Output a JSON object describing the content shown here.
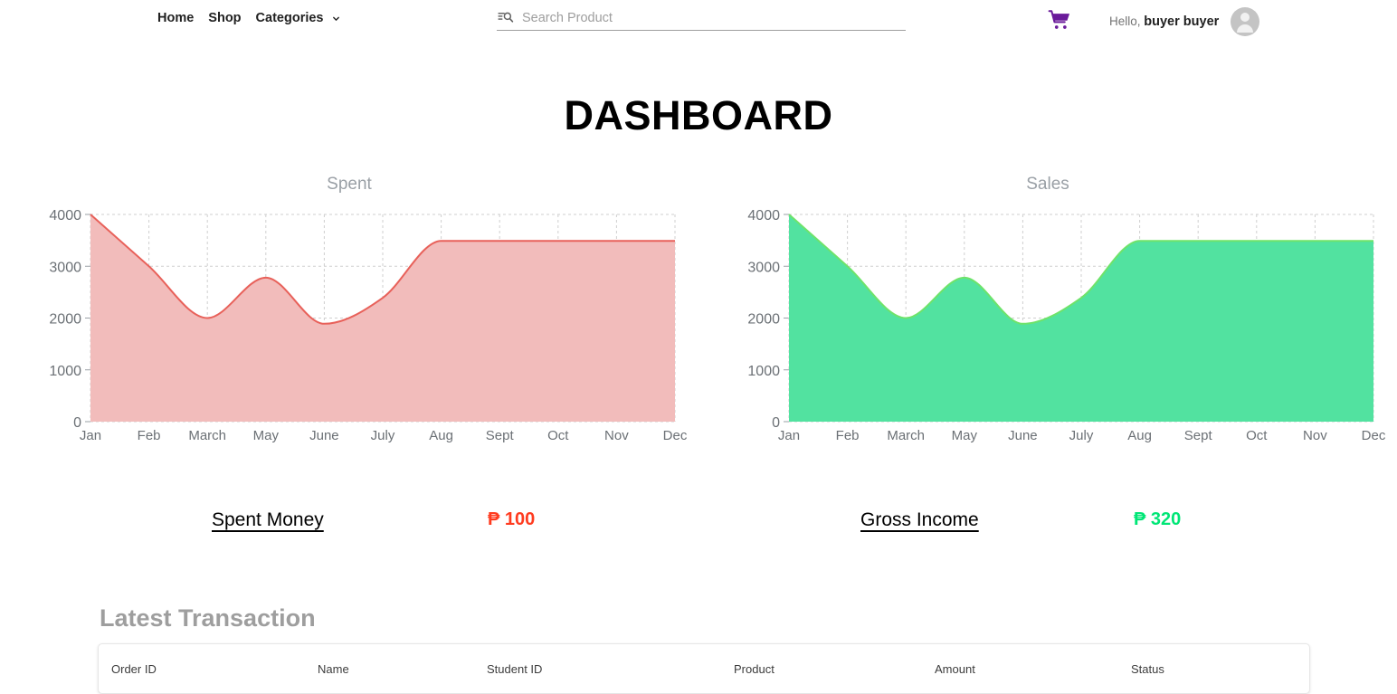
{
  "header": {
    "nav": [
      {
        "label": "Home",
        "name": "nav-home"
      },
      {
        "label": "Shop",
        "name": "nav-shop"
      },
      {
        "label": "Categories",
        "name": "nav-categories"
      }
    ],
    "search": {
      "placeholder": "Search Product",
      "value": "",
      "icon": "manage-search-icon"
    },
    "cart_icon": "shopping-cart-icon",
    "cart_color": "#6a1b9a",
    "greeting_prefix": "Hello,",
    "user_name": "buyer buyer",
    "avatar_icon": "account-circle-icon"
  },
  "page_title": "DASHBOARD",
  "summary": {
    "spent": {
      "label": "Spent Money",
      "value": "₱ 100",
      "color": "#ff3b1f"
    },
    "income": {
      "label": "Gross Income",
      "value": "₱ 320",
      "color": "#00e676"
    }
  },
  "transactions": {
    "heading": "Latest Transaction",
    "columns": [
      "Order ID",
      "Name",
      "Student ID",
      "Product",
      "Amount",
      "Status"
    ],
    "rows": []
  },
  "chart_data": [
    {
      "type": "area",
      "title": "Spent",
      "categories": [
        "Jan",
        "Feb",
        "March",
        "May",
        "June",
        "July",
        "Aug",
        "Sept",
        "Oct",
        "Nov",
        "Dec"
      ],
      "values": [
        4000,
        3000,
        2000,
        2780,
        1890,
        2390,
        3490,
        3490,
        3490,
        3490,
        3490
      ],
      "xlabel": "",
      "ylabel": "",
      "ylim": [
        0,
        4000
      ],
      "yticks": [
        0,
        1000,
        2000,
        3000,
        4000
      ],
      "grid": true,
      "legend": "none",
      "line_color": "#e8615a",
      "fill_color": "#f2bcbb"
    },
    {
      "type": "area",
      "title": "Sales",
      "categories": [
        "Jan",
        "Feb",
        "March",
        "May",
        "June",
        "July",
        "Aug",
        "Sept",
        "Oct",
        "Nov",
        "Dec"
      ],
      "values": [
        4000,
        3000,
        2000,
        2780,
        1890,
        2390,
        3490,
        3490,
        3490,
        3490,
        3490
      ],
      "xlabel": "",
      "ylabel": "",
      "ylim": [
        0,
        4000
      ],
      "yticks": [
        0,
        1000,
        2000,
        3000,
        4000
      ],
      "grid": true,
      "legend": "none",
      "line_color": "#6ee36a",
      "fill_color": "#52e2a0"
    }
  ]
}
